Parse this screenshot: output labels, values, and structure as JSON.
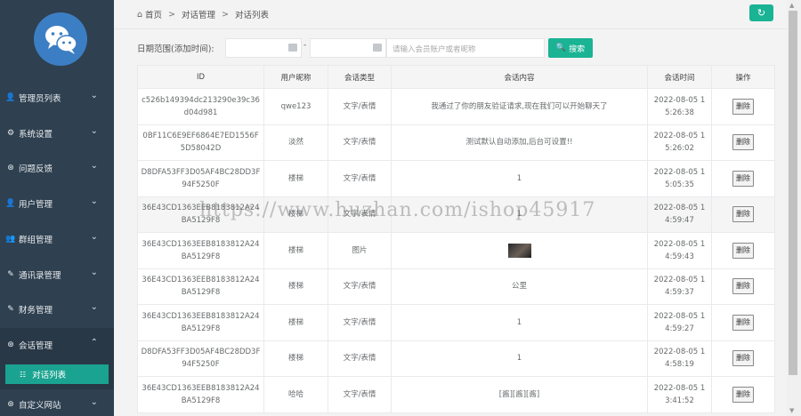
{
  "sidebar": {
    "items": [
      {
        "label": "管理员列表",
        "icon": "user-icon",
        "glyph": "👤"
      },
      {
        "label": "系统设置",
        "icon": "gear-icon",
        "glyph": "⚙"
      },
      {
        "label": "问题反馈",
        "icon": "question-icon",
        "glyph": "⊛"
      },
      {
        "label": "用户管理",
        "icon": "user-icon",
        "glyph": "👤"
      },
      {
        "label": "群组管理",
        "icon": "users-icon",
        "glyph": "👥"
      },
      {
        "label": "通讯录管理",
        "icon": "edit-icon",
        "glyph": "✎"
      },
      {
        "label": "财务管理",
        "icon": "edit-icon",
        "glyph": "✎"
      },
      {
        "label": "会话管理",
        "icon": "chat-icon",
        "glyph": "⊛"
      },
      {
        "label": "自定义网站",
        "icon": "chat-icon",
        "glyph": "⊛"
      }
    ],
    "sub_item": {
      "label": "对话列表",
      "icon": "list-icon",
      "glyph": "☷"
    }
  },
  "breadcrumb": {
    "home": "首页",
    "section": "对话管理",
    "current": "对话列表",
    "separator": ">"
  },
  "search": {
    "label": "日期范围(添加时间):",
    "dash": "-",
    "keyword_placeholder": "请输入会员账户或者昵称",
    "button_label": "搜索"
  },
  "table": {
    "headers": [
      "ID",
      "用户昵称",
      "会话类型",
      "会话内容",
      "会话时间",
      "操作"
    ],
    "delete_label": "删除",
    "rows": [
      {
        "id": "c526b149394dc213290e39c36d04d981",
        "nick": "qwe123",
        "type": "文字/表情",
        "content": "我通过了你的朋友验证请求,现在我们可以开始聊天了",
        "time": "2022-08-05 15:26:38"
      },
      {
        "id": "0BF11C6E9EF6864E7ED1556F5D58042D",
        "nick": "淡然",
        "type": "文字/表情",
        "content": "测试默认自动添加,后台可设置!!",
        "time": "2022-08-05 15:26:02"
      },
      {
        "id": "D8DFA53FF3D05AF4BC28DD3F94F5250F",
        "nick": "楼梯",
        "type": "文字/表情",
        "content": "1",
        "time": "2022-08-05 15:05:35"
      },
      {
        "id": "36E43CD1363EEB8183812A24BA5129F8",
        "nick": "楼梯",
        "type": "文字/表情",
        "content": "1",
        "time": "2022-08-05 14:59:47"
      },
      {
        "id": "36E43CD1363EEB8183812A24BA5129F8",
        "nick": "楼梯",
        "type": "图片",
        "content": "",
        "time": "2022-08-05 14:59:43"
      },
      {
        "id": "36E43CD1363EEB8183812A24BA5129F8",
        "nick": "楼梯",
        "type": "文字/表情",
        "content": "公里",
        "time": "2022-08-05 14:59:37"
      },
      {
        "id": "36E43CD1363EEB8183812A24BA5129F8",
        "nick": "楼梯",
        "type": "文字/表情",
        "content": "1",
        "time": "2022-08-05 14:59:27"
      },
      {
        "id": "D8DFA53FF3D05AF4BC28DD3F94F5250F",
        "nick": "楼梯",
        "type": "文字/表情",
        "content": "1",
        "time": "2022-08-05 14:58:19"
      },
      {
        "id": "36E43CD1363EEB8183812A24BA5129F8",
        "nick": "哈哈",
        "type": "文字/表情",
        "content": "[酱][酱][酱]",
        "time": "2022-08-05 13:41:52"
      }
    ]
  },
  "watermark": "https://www.huzhan.com/ishop45917",
  "colors": {
    "sidebar": "#2f4050",
    "accent": "#1ab394",
    "active_sub": "#1aa390"
  }
}
